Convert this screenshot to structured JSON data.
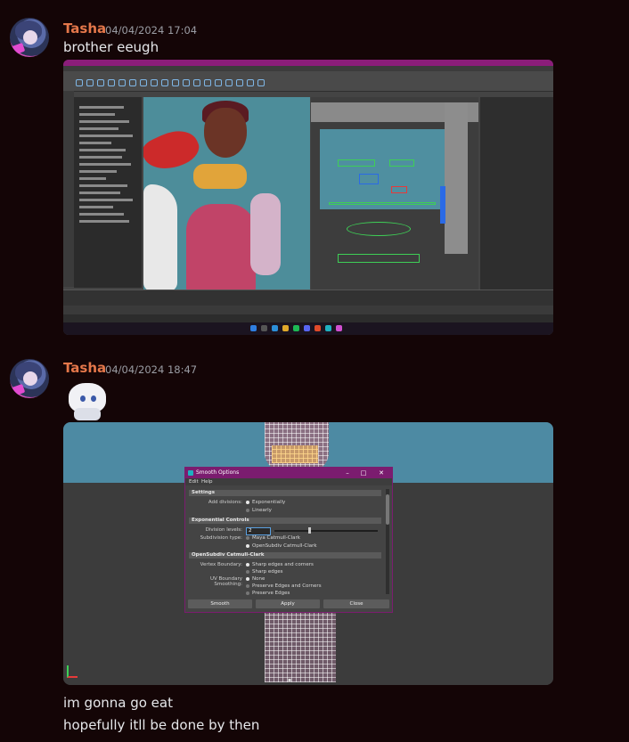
{
  "messages": [
    {
      "author": "Tasha",
      "timestamp": "04/04/2024 17:04",
      "text": "brother eeugh",
      "attachment": "maya-viewport-screenshot"
    },
    {
      "author": "Tasha",
      "timestamp": "04/04/2024 18:47",
      "sticker": "chibi-white-hair-sticker",
      "attachment": "maya-smooth-options-screenshot",
      "lines": [
        "im gonna go eat",
        "hopefully itll be done by then"
      ]
    }
  ],
  "smooth_dialog": {
    "title": "Smooth Options",
    "menu": [
      "Edit",
      "Help"
    ],
    "sections": {
      "settings": "Settings",
      "exponential": "Exponential Controls",
      "opensubdiv": "OpenSubdiv Catmull-Clark"
    },
    "add_divisions_label": "Add divisions:",
    "add_divisions_options": [
      "Exponentially",
      "Linearly"
    ],
    "add_divisions_selected": 0,
    "division_levels_label": "Division levels:",
    "division_levels_value": "2",
    "subdivision_type_label": "Subdivision type:",
    "subdivision_type_options": [
      "Maya Catmull-Clark",
      "OpenSubdiv Catmull-Clark"
    ],
    "subdivision_type_selected": 1,
    "vertex_boundary_label": "Vertex Boundary:",
    "vertex_boundary_options": [
      "Sharp edges and corners",
      "Sharp edges"
    ],
    "vertex_boundary_selected": 0,
    "uv_boundary_label": "UV Boundary Smoothing:",
    "uv_boundary_options": [
      "None",
      "Preserve Edges and Corners",
      "Preserve Edges"
    ],
    "uv_boundary_selected": 0,
    "buttons": [
      "Smooth",
      "Apply",
      "Close"
    ]
  },
  "colors": {
    "username": "#e4774a",
    "maya_accent": "#7b1c6f",
    "background": "#140506"
  }
}
